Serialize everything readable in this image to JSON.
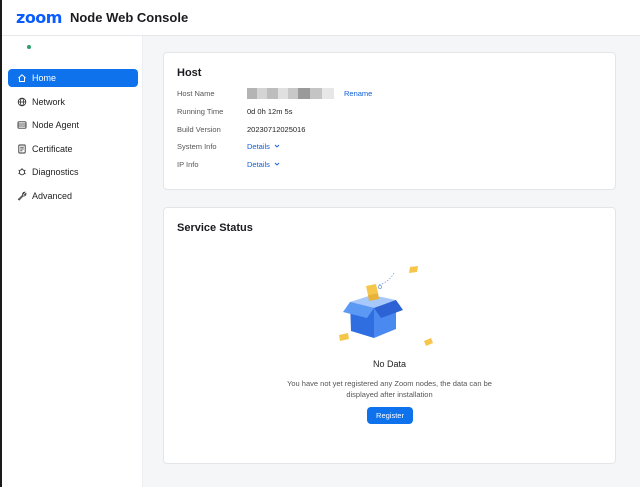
{
  "app": {
    "logo": "zoom",
    "title": "Node Web Console"
  },
  "colors": {
    "accent": "#0e72ed",
    "link": "#0e5fd8",
    "status": "#2e9e6a"
  },
  "sidebar": {
    "items": [
      {
        "label": "Home",
        "icon": "home-icon",
        "active": true
      },
      {
        "label": "Network",
        "icon": "globe-icon"
      },
      {
        "label": "Node Agent",
        "icon": "node-agent-icon"
      },
      {
        "label": "Certificate",
        "icon": "certificate-icon"
      },
      {
        "label": "Diagnostics",
        "icon": "diagnostics-icon"
      },
      {
        "label": "Advanced",
        "icon": "wrench-icon"
      }
    ]
  },
  "host": {
    "title": "Host",
    "host_name_label": "Host Name",
    "rename": "Rename",
    "running_time_label": "Running Time",
    "running_time": "0d 0h 12m 5s",
    "build_version_label": "Build Version",
    "build_version": "20230712025016",
    "system_info_label": "System Info",
    "system_info_link": "Details",
    "ip_info_label": "IP Info",
    "ip_info_link": "Details"
  },
  "service": {
    "title": "Service Status",
    "empty_title": "No Data",
    "empty_desc_line1": "You have not yet registered any Zoom nodes, the data can be",
    "empty_desc_line2": "displayed after installation",
    "register": "Register"
  }
}
